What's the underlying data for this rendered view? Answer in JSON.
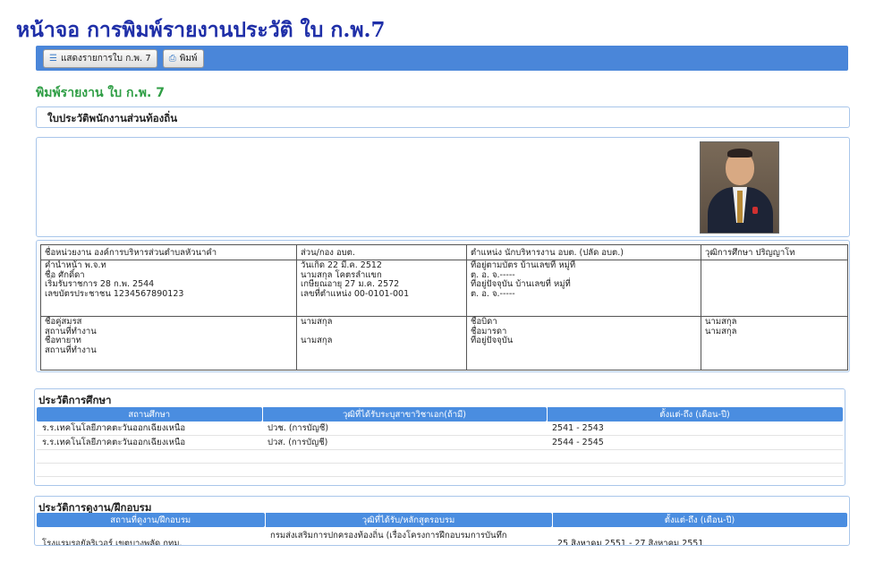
{
  "headline": "หน้าจอ การพิมพ์รายงานประวัติ ใบ ก.พ.7",
  "toolbar": {
    "show_label": "แสดงรายการใบ ก.พ. 7",
    "print_label": "พิมพ์"
  },
  "page_heading": "พิมพ์รายงาน ใบ ก.พ. 7",
  "form_title": "ใบประวัติพนักงานส่วนท้องถิ่น",
  "header_row": [
    "ชื่อหน่วยงาน องค์การบริหารส่วนตำบลหัวนาคำ",
    "ส่วน/กอง อบต.",
    "ตำแหน่ง นักบริหารงาน อบต. (ปลัด อบต.)",
    "วุฒิการศึกษา ปริญญาโท"
  ],
  "personal": {
    "col1": [
      "คำนำหน้า พ.จ.ท",
      "ชื่อ ศักดิ์ดา",
      "เริ่มรับราชการ 28 ก.พ. 2544",
      "เลขบัตรประชาชน 1234567890123"
    ],
    "col2": [
      "วันเกิด 22 มี.ค. 2512",
      "นามสกุล โคตรลำแขก",
      "เกษียณอายุ 27 ม.ค. 2572",
      "เลขที่ตำแหน่ง 00-0101-001"
    ],
    "col3": [
      "ที่อยู่ตามบัตร บ้านเลขที่ หมู่ที่",
      "ต. อ. จ.-----",
      "ที่อยู่ปัจจุบัน บ้านเลขที่ หมู่ที่",
      "ต. อ. จ.-----"
    ]
  },
  "family": {
    "col1": [
      "ชื่อคู่สมรส",
      "สถานที่ทำงาน",
      "ชื่อทายาท",
      "สถานที่ทำงาน"
    ],
    "col2": [
      "นามสกุล",
      "",
      "นามสกุล",
      ""
    ],
    "col3": [
      "ชื่อบิดา",
      "ชื่อมารดา",
      "ที่อยู่ปัจจุบัน",
      ""
    ],
    "col4": [
      "นามสกุล",
      "นามสกุล",
      "",
      ""
    ]
  },
  "education": {
    "title": "ประวัติการศึกษา",
    "headers": [
      "สถานศึกษา",
      "วุฒิที่ได้รับระบุสาขาวิชาเอก(ถ้ามี)",
      "ตั้งแต่-ถึง (เดือน-ปี)"
    ],
    "rows": [
      [
        "ร.ร.เทคโนโลยีภาคตะวันออกเฉียงเหนือ",
        "ปวช. (การบัญชี)",
        "2541 - 2543"
      ],
      [
        "ร.ร.เทคโนโลยีภาคตะวันออกเฉียงเหนือ",
        "ปวส. (การบัญชี)",
        "2544 - 2545"
      ]
    ]
  },
  "training": {
    "title": "ประวัติการดูงาน/ฝึกอบรม",
    "headers": [
      "สถานที่ดูงาน/ฝึกอบรม",
      "วุฒิที่ได้รับ/หลักสูตรอบรม",
      "ตั้งแต่-ถึง (เดือน-ปี)"
    ],
    "row": {
      "place": "โรงแรมรอยัลริเวอร์ เขตบางพลัด กทม.",
      "course": "กรมส่งเสริมการปกครองท้องถิ่น (เรื่องโครงการฝึกอบรมการบันทึก",
      "period": "25 สิงหาคม 2551 - 27 สิงหาคม 2551"
    }
  }
}
